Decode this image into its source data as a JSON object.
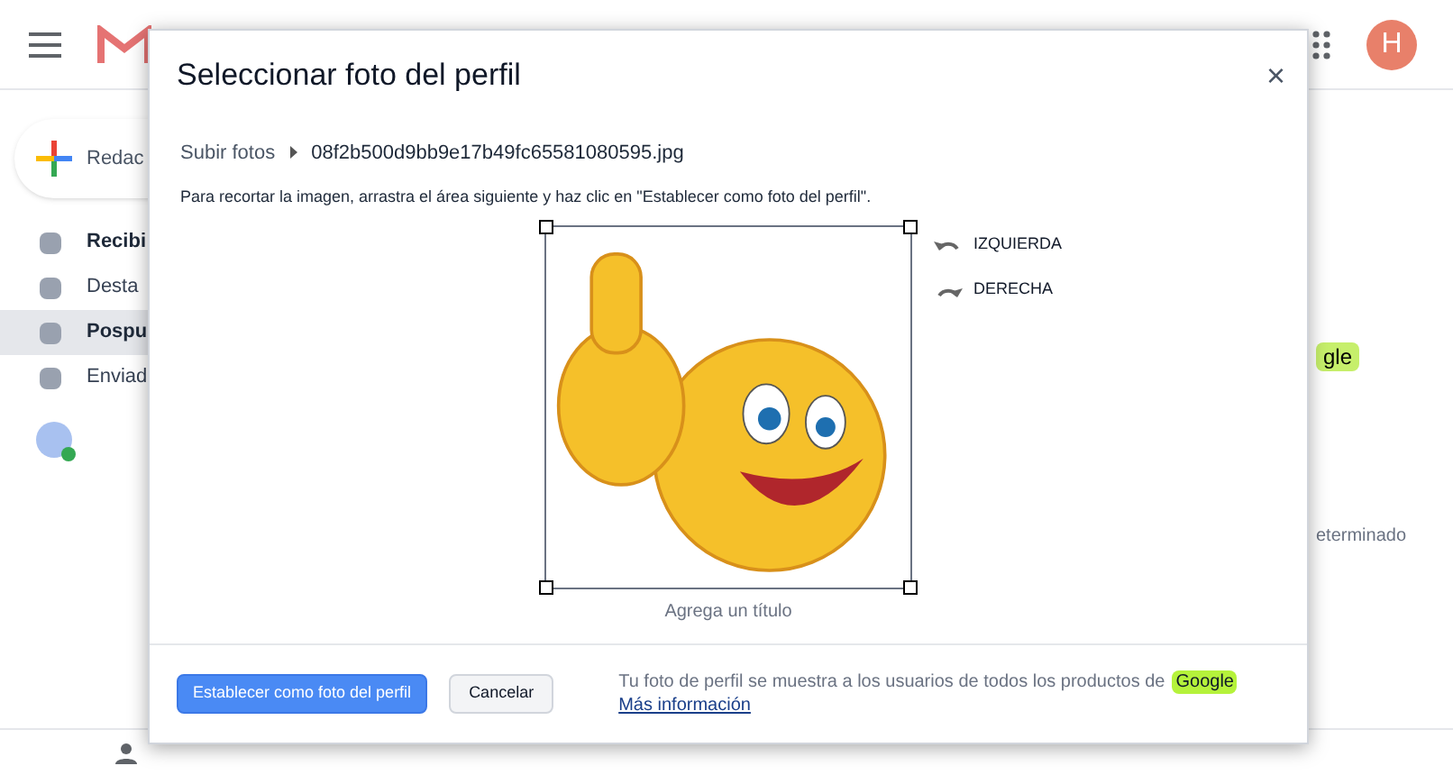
{
  "app_bar": {
    "avatar_letter": "H"
  },
  "sidebar": {
    "compose_label": "Redac",
    "items": [
      {
        "label": "Recibi",
        "bold": true,
        "selected": false
      },
      {
        "label": "Desta",
        "bold": false,
        "selected": false
      },
      {
        "label": "Pospu",
        "bold": true,
        "selected": true
      },
      {
        "label": "Enviad",
        "bold": false,
        "selected": false
      }
    ]
  },
  "background": {
    "badge": "gle",
    "note": "eterminado"
  },
  "dialog": {
    "title": "Seleccionar foto del perfil",
    "close": "×",
    "breadcrumb": [
      "Subir fotos",
      "08f2b500d9bb9e17b49fc65581080595.jpg"
    ],
    "instruction": "Para recortar la imagen, arrastra el área siguiente y haz clic en \"Establecer como foto del perfil\".",
    "rotate": [
      {
        "label": "IZQUIERDA",
        "kind": "left"
      },
      {
        "label": "DERECHA",
        "kind": "right"
      }
    ],
    "caption_placeholder": "Agrega un título",
    "buttons": [
      {
        "label": "Establecer como foto del perfil",
        "kind": "primary"
      },
      {
        "label": "Cancelar",
        "kind": "secondary"
      }
    ],
    "footer_note": "Tu foto de perfil se muestra a los usuarios de todos los productos de",
    "footer_brand": "Google",
    "footer_link": "Más información"
  }
}
